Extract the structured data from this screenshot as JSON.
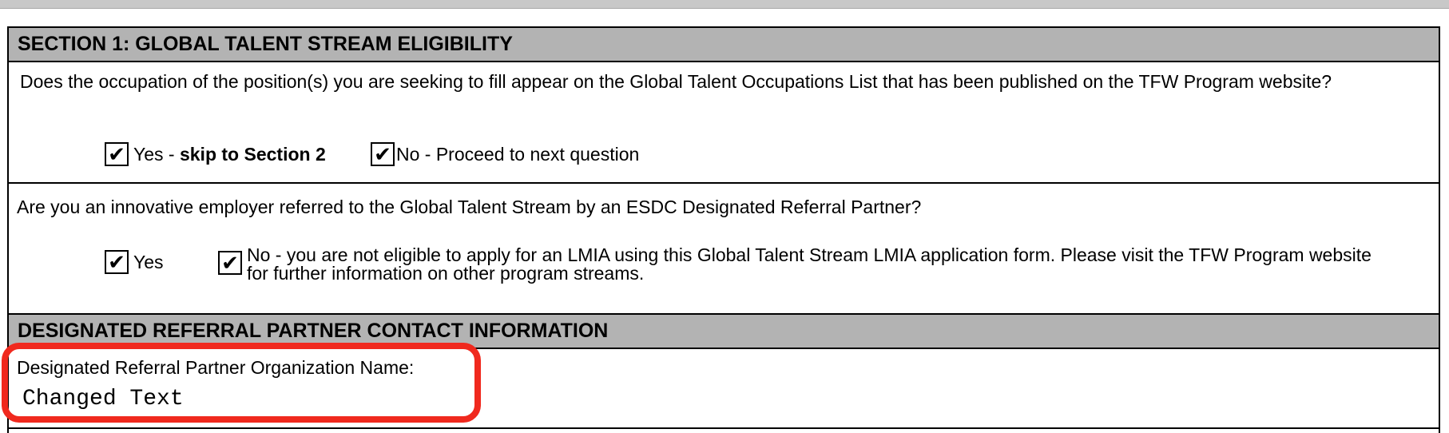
{
  "section1": {
    "title": "SECTION 1:  GLOBAL TALENT STREAM ELIGIBILITY",
    "question1": {
      "text": "Does the occupation of the position(s) you are seeking to fill appear on the Global Talent Occupations List that has been published on the TFW Program website?",
      "yes": {
        "checked": "✔",
        "prefix": "Yes - ",
        "bold": "skip to Section 2"
      },
      "no": {
        "checked": "✔",
        "label": "No - Proceed to next question"
      }
    },
    "question2": {
      "text": "Are you an innovative employer referred to the Global Talent Stream by an ESDC Designated Referral Partner?",
      "yes": {
        "checked": "✔",
        "label": "Yes"
      },
      "no": {
        "checked": "✔",
        "label": "No - you are not eligible to apply for an LMIA using this Global Talent Stream LMIA application form. Please visit the TFW Program website for further information on other program streams."
      }
    }
  },
  "referral": {
    "title": "DESIGNATED REFERRAL PARTNER CONTACT INFORMATION",
    "org_name_label": "Designated Referral Partner Organization Name:",
    "org_name_value": "Changed Text"
  },
  "colors": {
    "header_bg": "#b3b3b3",
    "highlight": "#f0291e"
  }
}
